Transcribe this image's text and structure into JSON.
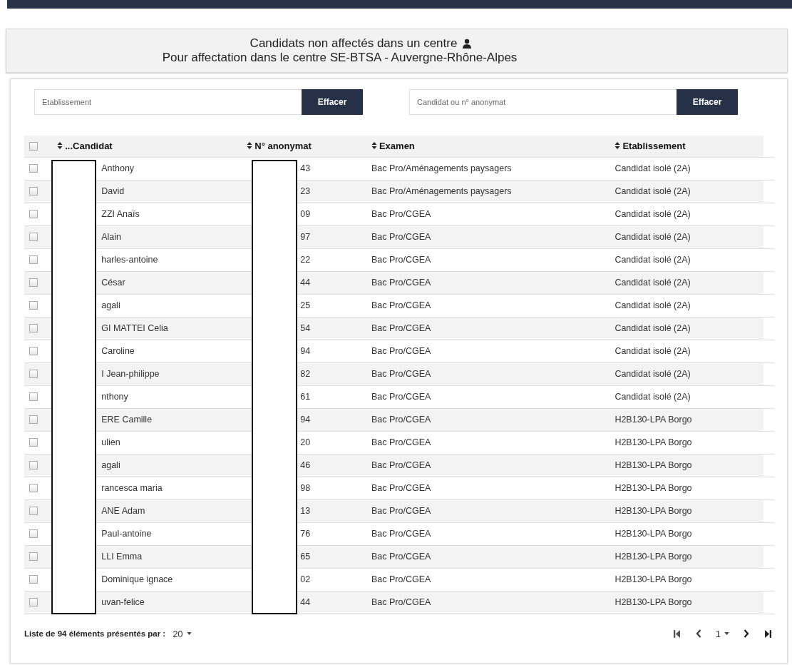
{
  "header": {
    "title": "Candidats non affectés dans un centre",
    "subtitle": "Pour affectation dans le centre SE-BTSA - Auvergne-Rhône-Alpes"
  },
  "filters": [
    {
      "placeholder": "Etablissement",
      "button": "Effacer"
    },
    {
      "placeholder": "Candidat ou n° anonymat",
      "button": "Effacer"
    }
  ],
  "table": {
    "select_all": {
      "checked": false
    },
    "columns": [
      "...Candidat",
      "N° anonymat",
      "Examen",
      "Etablissement"
    ],
    "rows": [
      {
        "checked": false,
        "candidat": "Anthony",
        "anonymat": "43",
        "examen": "Bac Pro/Aménagements paysagers",
        "etablissement": "Candidat isolé (2A)"
      },
      {
        "checked": false,
        "candidat": "David",
        "anonymat": "23",
        "examen": "Bac Pro/Aménagements paysagers",
        "etablissement": "Candidat isolé (2A)"
      },
      {
        "checked": false,
        "candidat": "ZZI Anaïs",
        "anonymat": "09",
        "examen": "Bac Pro/CGEA",
        "etablissement": "Candidat isolé (2A)"
      },
      {
        "checked": false,
        "candidat": "Alain",
        "anonymat": "97",
        "examen": "Bac Pro/CGEA",
        "etablissement": "Candidat isolé (2A)"
      },
      {
        "checked": false,
        "candidat": "harles-antoine",
        "anonymat": "22",
        "examen": "Bac Pro/CGEA",
        "etablissement": "Candidat isolé (2A)"
      },
      {
        "checked": false,
        "candidat": "César",
        "anonymat": "44",
        "examen": "Bac Pro/CGEA",
        "etablissement": "Candidat isolé (2A)"
      },
      {
        "checked": false,
        "candidat": "agali",
        "anonymat": "25",
        "examen": "Bac Pro/CGEA",
        "etablissement": "Candidat isolé (2A)"
      },
      {
        "checked": false,
        "candidat": "GI MATTEI Celia",
        "anonymat": "54",
        "examen": "Bac Pro/CGEA",
        "etablissement": "Candidat isolé (2A)"
      },
      {
        "checked": false,
        "candidat": "Caroline",
        "anonymat": "94",
        "examen": "Bac Pro/CGEA",
        "etablissement": "Candidat isolé (2A)"
      },
      {
        "checked": false,
        "candidat": "I Jean-philippe",
        "anonymat": "82",
        "examen": "Bac Pro/CGEA",
        "etablissement": "Candidat isolé (2A)"
      },
      {
        "checked": false,
        "candidat": "nthony",
        "anonymat": "61",
        "examen": "Bac Pro/CGEA",
        "etablissement": "Candidat isolé (2A)"
      },
      {
        "checked": false,
        "candidat": "ERE Camille",
        "anonymat": "94",
        "examen": "Bac Pro/CGEA",
        "etablissement": "H2B130-LPA Borgo"
      },
      {
        "checked": false,
        "candidat": "ulien",
        "anonymat": "20",
        "examen": "Bac Pro/CGEA",
        "etablissement": "H2B130-LPA Borgo"
      },
      {
        "checked": false,
        "candidat": "agali",
        "anonymat": "46",
        "examen": "Bac Pro/CGEA",
        "etablissement": "H2B130-LPA Borgo"
      },
      {
        "checked": false,
        "candidat": "rancesca maria",
        "anonymat": "98",
        "examen": "Bac Pro/CGEA",
        "etablissement": "H2B130-LPA Borgo"
      },
      {
        "checked": false,
        "candidat": "ANE Adam",
        "anonymat": "13",
        "examen": "Bac Pro/CGEA",
        "etablissement": "H2B130-LPA Borgo"
      },
      {
        "checked": false,
        "candidat": "Paul-antoine",
        "anonymat": "76",
        "examen": "Bac Pro/CGEA",
        "etablissement": "H2B130-LPA Borgo"
      },
      {
        "checked": false,
        "candidat": "LLI Emma",
        "anonymat": "65",
        "examen": "Bac Pro/CGEA",
        "etablissement": "H2B130-LPA Borgo"
      },
      {
        "checked": false,
        "candidat": "Dominique ignace",
        "anonymat": "02",
        "examen": "Bac Pro/CGEA",
        "etablissement": "H2B130-LPA Borgo"
      },
      {
        "checked": false,
        "candidat": "uvan-felice",
        "anonymat": "44",
        "examen": "Bac Pro/CGEA",
        "etablissement": "H2B130-LPA Borgo"
      }
    ]
  },
  "footer": {
    "summary": "Liste de 94 éléments présentés par :",
    "page_size": "20",
    "page": "1"
  }
}
